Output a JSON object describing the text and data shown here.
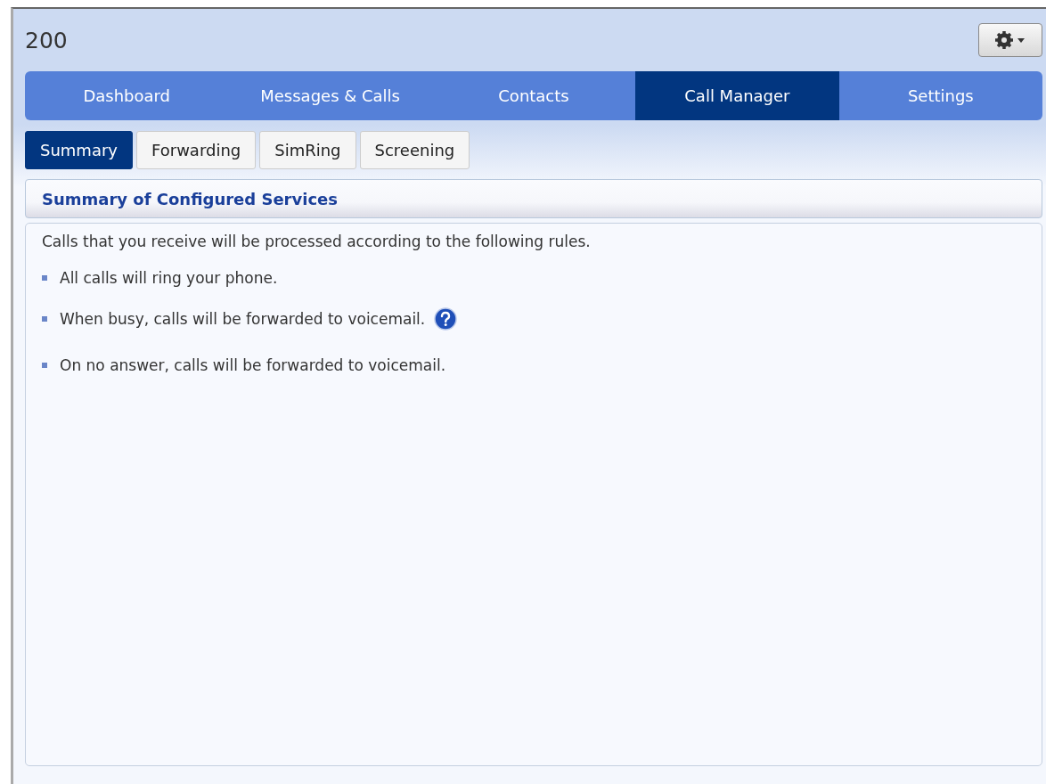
{
  "header": {
    "title": "200"
  },
  "nav_tabs": [
    {
      "label": "Dashboard",
      "selected": false
    },
    {
      "label": "Messages & Calls",
      "selected": false
    },
    {
      "label": "Contacts",
      "selected": false
    },
    {
      "label": "Call Manager",
      "selected": true
    },
    {
      "label": "Settings",
      "selected": false
    }
  ],
  "sub_tabs": [
    {
      "label": "Summary",
      "selected": true
    },
    {
      "label": "Forwarding",
      "selected": false
    },
    {
      "label": "SimRing",
      "selected": false
    },
    {
      "label": "Screening",
      "selected": false
    }
  ],
  "section": {
    "title": "Summary of Configured Services",
    "intro": "Calls that you receive will be processed according to the following rules.",
    "rules": [
      {
        "text": "All calls will ring your phone.",
        "help": false
      },
      {
        "text": "When busy, calls will be forwarded to voicemail.",
        "help": true
      },
      {
        "text": "On no answer, calls will be forwarded to voicemail.",
        "help": false
      }
    ]
  }
}
